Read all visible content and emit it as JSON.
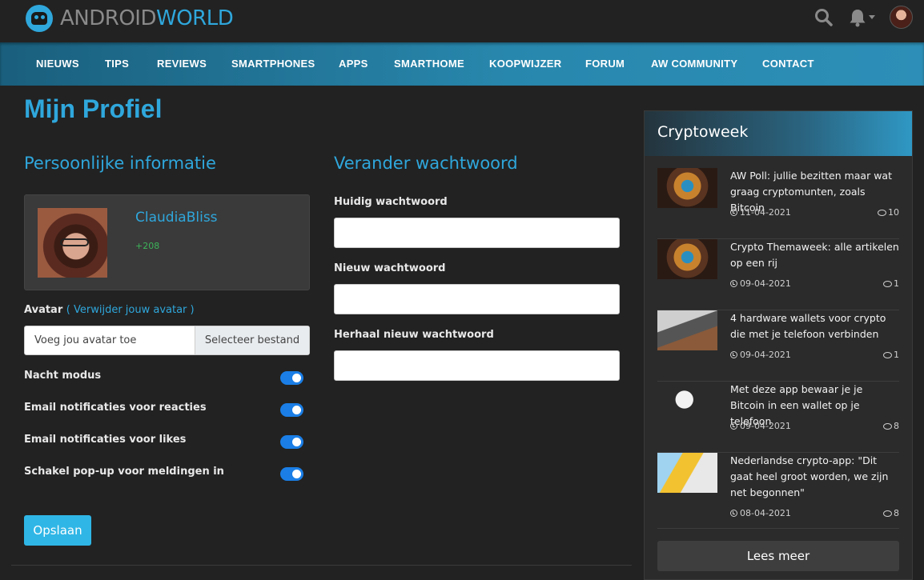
{
  "brand": {
    "part1": "ANDROID",
    "part2": "WORLD"
  },
  "header_icons": [
    "search-icon",
    "bell-icon",
    "chevron-down-icon",
    "user-avatar"
  ],
  "nav": [
    "NIEUWS",
    "TIPS",
    "REVIEWS",
    "SMARTPHONES",
    "APPS",
    "SMARTHOME",
    "KOOPWIJZER",
    "FORUM",
    "AW COMMUNITY",
    "CONTACT"
  ],
  "page": {
    "title": "Mijn Profiel"
  },
  "personal": {
    "title": "Persoonlijke informatie",
    "username": "ClaudiaBliss",
    "points": "+208",
    "avatar_label": "Avatar",
    "avatar_remove_link": "( Verwijder jouw avatar )",
    "file_placeholder": "Voeg jou avatar toe",
    "file_button": "Selecteer bestand",
    "toggles": [
      {
        "label": "Nacht modus",
        "on": true
      },
      {
        "label": "Email notificaties voor reacties",
        "on": true
      },
      {
        "label": "Email notificaties voor likes",
        "on": true
      },
      {
        "label": "Schakel pop-up voor meldingen in",
        "on": true
      }
    ],
    "save_label": "Opslaan"
  },
  "password": {
    "title": "Verander wachtwoord",
    "current_label": "Huidig wachtwoord",
    "new_label": "Nieuw wachtwoord",
    "repeat_label": "Herhaal nieuw wachtwoord"
  },
  "sidebar": {
    "title": "Cryptoweek",
    "articles": [
      {
        "title": "AW Poll: jullie bezitten maar wat graag cryptomunten, zoals Bitcoin",
        "date": "11-04-2021",
        "comments": "10"
      },
      {
        "title": "Crypto Themaweek: alle artikelen op een rij",
        "date": "09-04-2021",
        "comments": "1"
      },
      {
        "title": "4 hardware wallets voor crypto die met je telefoon verbinden",
        "date": "09-04-2021",
        "comments": "1"
      },
      {
        "title": "Met deze app bewaar je je Bitcoin in een wallet op je telefoon",
        "date": "09-04-2021",
        "comments": "8"
      },
      {
        "title": "Nederlandse crypto-app: \"Dit gaat heel groot worden, we zijn net begonnen\"",
        "date": "08-04-2021",
        "comments": "8"
      }
    ],
    "more_label": "Lees meer"
  }
}
